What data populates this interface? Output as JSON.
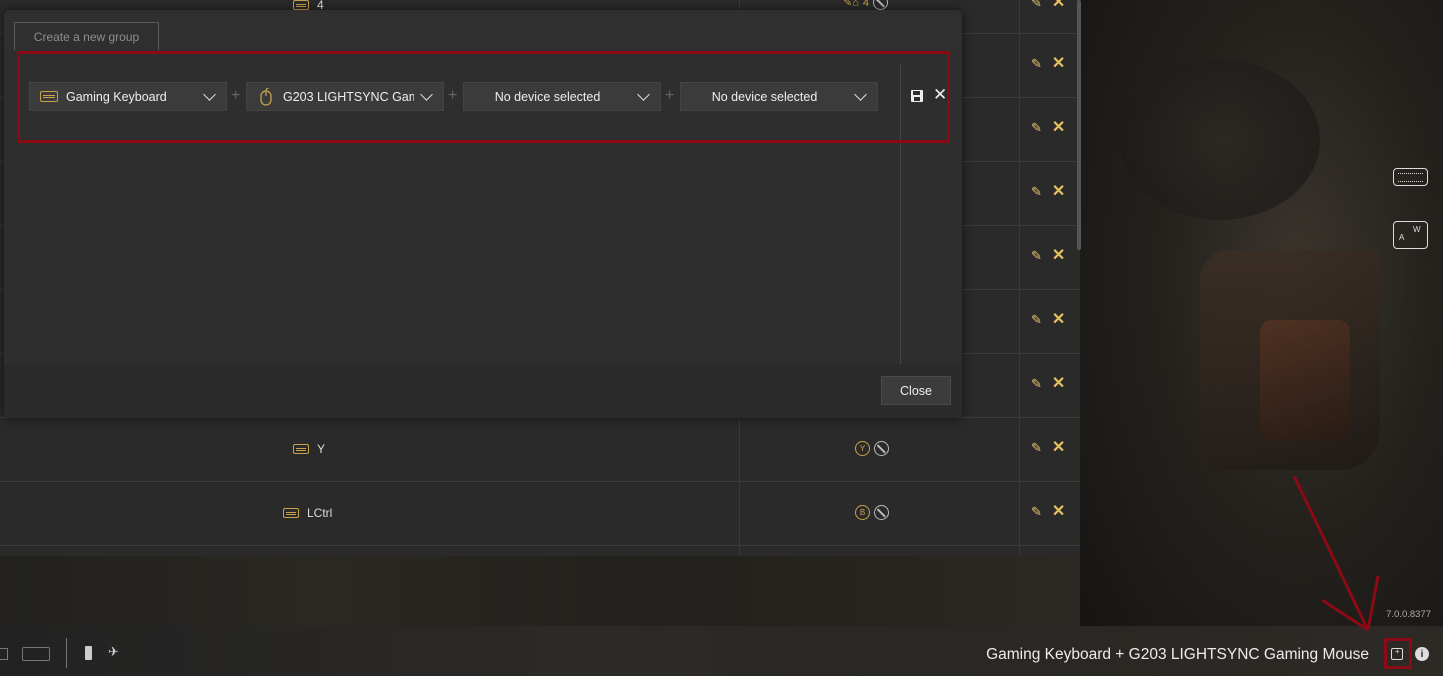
{
  "dialog": {
    "create_tab_label": "Create a new group",
    "devices": [
      {
        "label": "Gaming Keyboard",
        "icon": "keyboard-icon"
      },
      {
        "label": "G203 LIGHTSYNC Gami...",
        "icon": "mouse-icon"
      },
      {
        "label": "No device selected",
        "icon": ""
      },
      {
        "label": "No device selected",
        "icon": ""
      }
    ],
    "close_label": "Close"
  },
  "table": {
    "rows": [
      {
        "key": "4",
        "binding": "4"
      },
      {
        "key": "Y",
        "binding": "Y"
      },
      {
        "key": "LCtrl",
        "binding": "B"
      }
    ]
  },
  "footer": {
    "group_title": "Gaming Keyboard + G203 LIGHTSYNC Gaming Mouse",
    "version": "7.0.0.8377"
  },
  "colors": {
    "accent": "#c9a24a",
    "annotation_red": "#8b0a14",
    "dialog_bg": "#2f2f2f"
  }
}
